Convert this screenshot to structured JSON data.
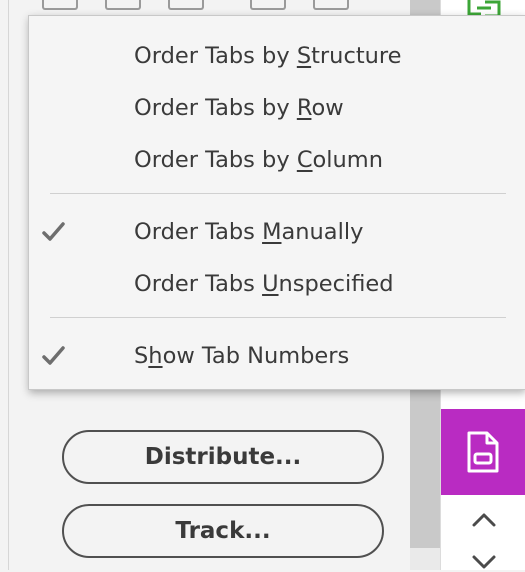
{
  "menu": {
    "items": [
      {
        "pre": "Order Tabs by ",
        "key": "S",
        "post": "tructure",
        "checked": false
      },
      {
        "pre": "Order Tabs by ",
        "key": "R",
        "post": "ow",
        "checked": false
      },
      {
        "pre": "Order Tabs by ",
        "key": "C",
        "post": "olumn",
        "checked": false
      },
      {
        "pre": "Order Tabs ",
        "key": "M",
        "post": "anually",
        "checked": true
      },
      {
        "pre": "Order Tabs ",
        "key": "U",
        "post": "nspecified",
        "checked": false
      },
      {
        "pre": "S",
        "key": "h",
        "post": "ow Tab Numbers",
        "checked": true
      }
    ]
  },
  "panel": {
    "distribute_label": "Distribute...",
    "track_label": "Track..."
  },
  "rail": {
    "active_tool_icon": "document-save-icon",
    "accent_color": "#b92bc2",
    "top_icon": "export-icon",
    "scroll_up_icon": "chevron-up-icon",
    "scroll_down_icon": "chevron-down-icon"
  }
}
